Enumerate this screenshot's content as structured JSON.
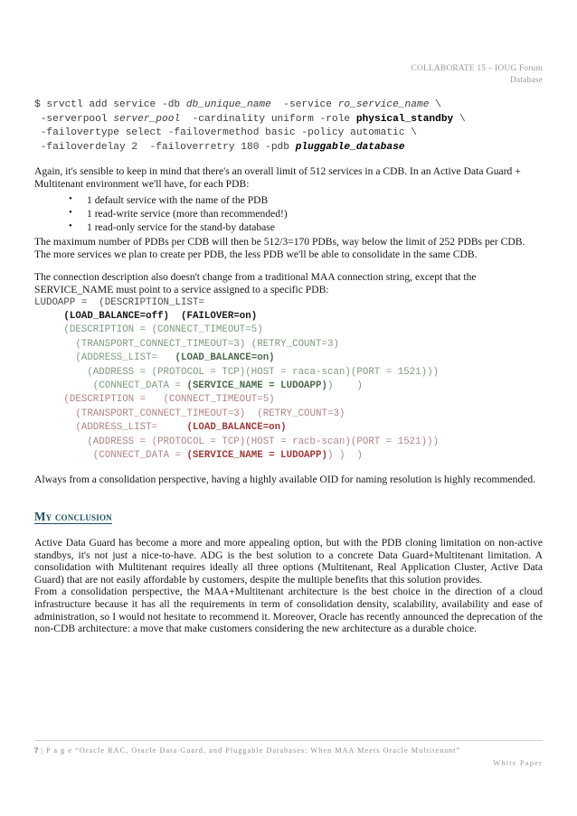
{
  "header": {
    "line1": "COLLABORATE 15 – IOUG Forum",
    "line2": "Database"
  },
  "srvctl_command": {
    "line1_a": "$ srvctl add service -db ",
    "line1_b": "db_unique_name",
    "line1_c": "  -service ",
    "line1_d": "ro_service_name",
    "line1_e": " \\",
    "line2_a": " -serverpool ",
    "line2_b": "server_pool",
    "line2_c": "  -cardinality uniform -role ",
    "line2_d": "physical_standby",
    "line2_e": " \\",
    "line3": " -failovertype select -failovermethod basic -policy automatic \\",
    "line4_a": " -failoverdelay 2  -failoverretry 180 -pdb ",
    "line4_b": "pluggable_database"
  },
  "paragraphs": {
    "limits_intro": "Again, it's sensible to keep in mind that there's an overall limit of 512 services in a CDB. In an Active Data Guard + Multitenant environment we'll have, for each PDB:",
    "max_pdbs": "The maximum number of PDBs per CDB will then be 512/3=170 PDBs, way below the limit of 252 PDBs per CDB. The more services we plan to create per PDB, the less PDB we'll be able to consolidate in the same CDB.",
    "connection_desc": "The connection description also doesn't change from a traditional MAA connection string, except that the SERVICE_NAME must point to a service assigned to a specific PDB:",
    "oid_note": "Always from a consolidation perspective, having a highly available OID for naming resolution is highly recommended.",
    "conclusion_1": "Active Data Guard has become a more and more appealing option, but with the PDB cloning limitation on non-active standbys, it's not just a nice-to-have. ADG is the best solution to a concrete Data Guard+Multitenant limitation. A consolidation with Multitenant requires ideally all three options (Multitenant, Real Application Cluster, Active Data Guard) that are not easily affordable by customers, despite the multiple benefits that this solution provides.",
    "conclusion_2": "From a consolidation perspective, the MAA+Multitenant architecture is the best choice in the direction of a cloud infrastructure because it has all the requirements in term of consolidation density, scalability, availability and ease of administration, so I would not hesitate to recommend it. Moreover, Oracle has recently announced the deprecation of the non-CDB architecture: a move that make customers considering the new architecture as a durable choice."
  },
  "service_bullets": [
    "1 default service with the name of the PDB",
    "1 read-write service (more than recommended!)",
    "1 read-only service for the stand-by database"
  ],
  "tns": {
    "l01": "LUDOAPP =  (DESCRIPTION_LIST=",
    "l02": "(LOAD_BALANCE=off)  (FAILOVER=on)",
    "l03": "(DESCRIPTION = (CONNECT_TIMEOUT=5)",
    "l04": "(TRANSPORT_CONNECT_TIMEOUT=3) (RETRY_COUNT=3)",
    "l05_a": "(ADDRESS_LIST=   ",
    "l05_b": "(LOAD_BALANCE=on)",
    "l06": "(ADDRESS = (PROTOCOL = TCP)(HOST = raca-scan)(PORT = 1521)))",
    "l07_a": "(CONNECT_DATA = ",
    "l07_b": "(SERVICE_NAME = LUDOAPP)",
    "l07_c": ")    )",
    "l08": "(DESCRIPTION =   (CONNECT_TIMEOUT=5)",
    "l09": "(TRANSPORT_CONNECT_TIMEOUT=3)  (RETRY_COUNT=3)",
    "l10_a": "(ADDRESS_LIST=     ",
    "l10_b": "(LOAD_BALANCE=on)",
    "l11": "(ADDRESS = (PROTOCOL = TCP)(HOST = racb-scan)(PORT = 1521)))",
    "l12_a": "(CONNECT_DATA = ",
    "l12_b": "(SERVICE_NAME = LUDOAPP)",
    "l12_c": ") )  )"
  },
  "section_heading": "My conclusion",
  "footer": {
    "page_number": "7",
    "separator": " | ",
    "page_word": "P a g e",
    "title": "“Oracle RAC, Oracle Data Guard, and Pluggable Databases: When MAA Meets Oracle Multitenant”",
    "doc_type": "White Paper"
  },
  "colors": {
    "heading": "#1f4e5f",
    "block_a": "#7f9a7f",
    "block_b": "#b08585",
    "footer_text": "#8d8d8d"
  }
}
